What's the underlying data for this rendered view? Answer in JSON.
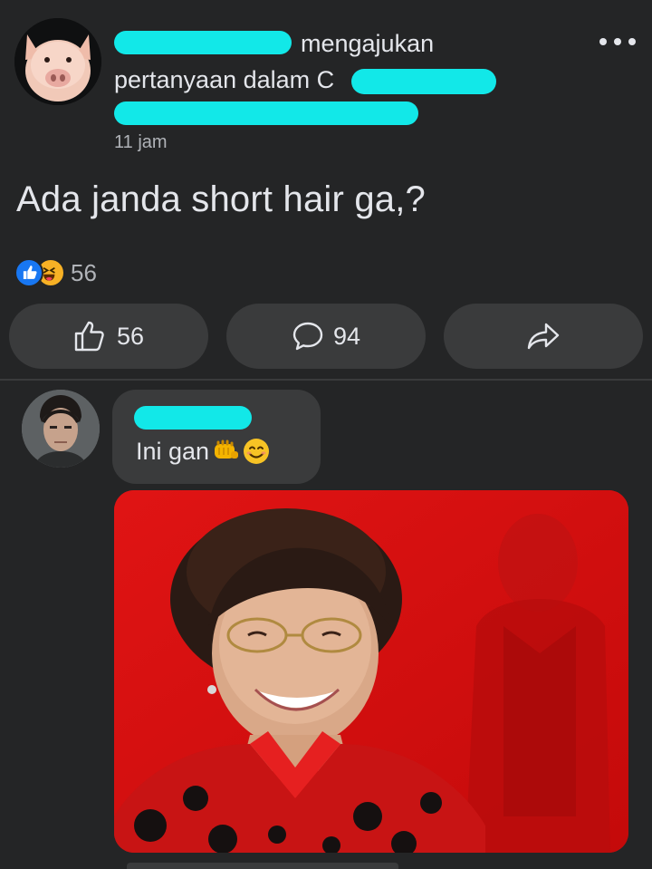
{
  "post": {
    "header_suffix": "mengajukan",
    "header_line2": "pertanyaan dalam C",
    "timestamp": "11 jam",
    "text": "Ada janda short hair ga,?",
    "more_icon": "more-dots-icon",
    "avatar_icon": "pig-avatar-icon"
  },
  "reactions": {
    "icons": [
      "like-reaction-icon",
      "haha-reaction-icon"
    ],
    "count": "56"
  },
  "actions": {
    "like_count": "56",
    "comment_count": "94",
    "like_icon": "thumbs-up-icon",
    "comment_icon": "comment-bubble-icon",
    "share_icon": "share-arrow-icon"
  },
  "comment": {
    "text": "Ini gan",
    "emojis": [
      "fist-bump-emoji",
      "smiling-face-emoji"
    ],
    "avatar_icon": "man-avatar-icon",
    "photo": "woman-red-background-photo"
  },
  "colors": {
    "background": "#242526",
    "button_bg": "#3a3b3c",
    "redaction": "#12e8e8",
    "like_blue": "#1877f2",
    "haha_yellow": "#f7b125",
    "photo_red": "#d81010"
  }
}
